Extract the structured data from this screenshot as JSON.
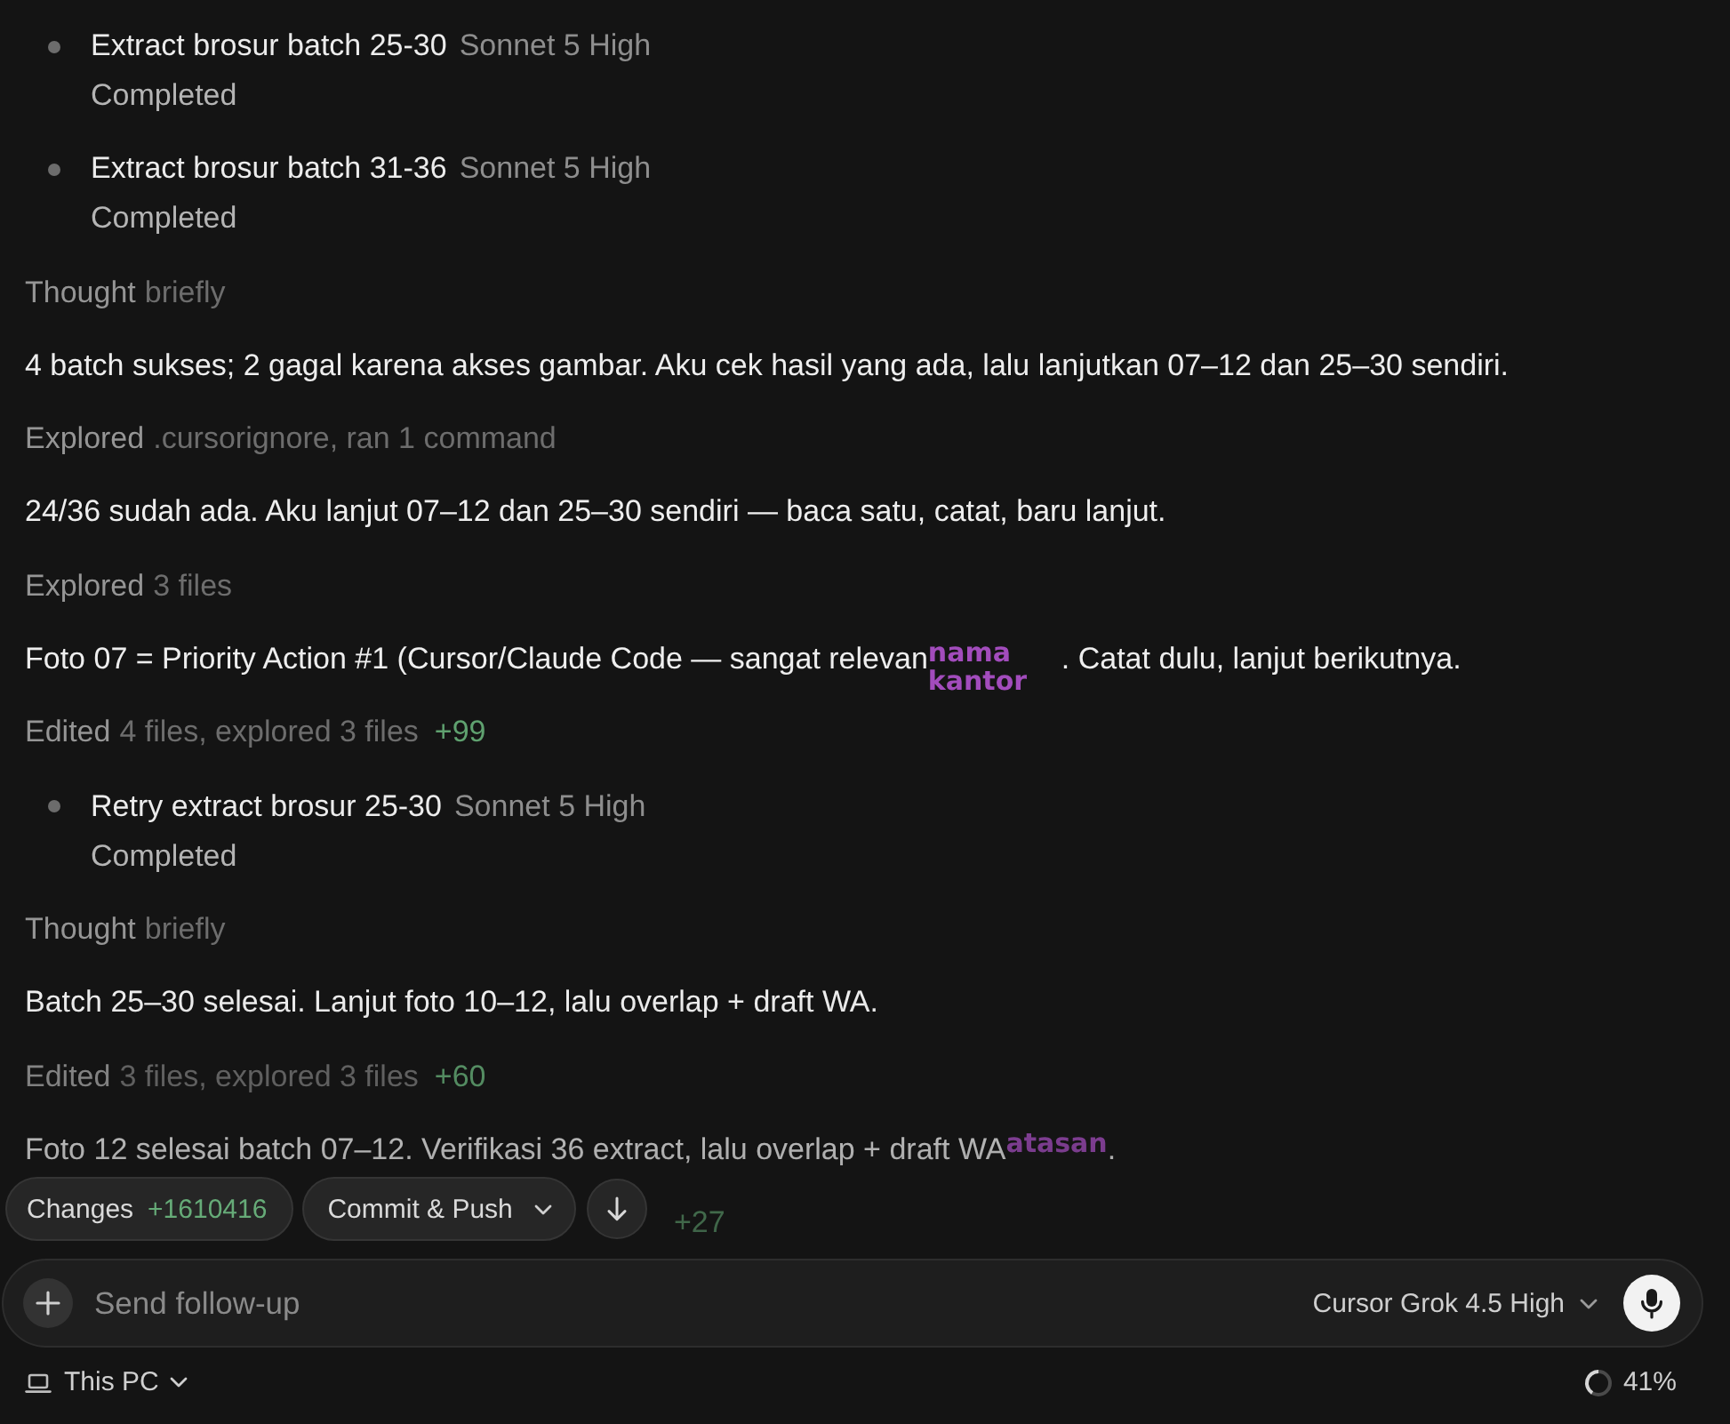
{
  "transcript": [
    {
      "kind": "task",
      "title": "Extract brosur batch 25-30",
      "model": "Sonnet 5 High",
      "status": "Completed"
    },
    {
      "kind": "task",
      "title": "Extract brosur batch 31-36",
      "model": "Sonnet 5 High",
      "status": "Completed"
    },
    {
      "kind": "summary",
      "label": "Thought",
      "detail": "briefly"
    },
    {
      "kind": "message",
      "text": "4 batch sukses; 2 gagal karena akses gambar. Aku cek hasil yang ada, lalu lanjutkan 07–12 dan 25–30 sendiri."
    },
    {
      "kind": "summary",
      "label": "Explored",
      "detail": ".cursorignore, ran 1 command"
    },
    {
      "kind": "message",
      "text": "24/36 sudah ada. Aku lanjut 07–12 dan 25–30 sendiri — baca satu, catat, baru lanjut."
    },
    {
      "kind": "summary",
      "label": "Explored",
      "detail": "3 files"
    },
    {
      "kind": "message",
      "parts": [
        {
          "kind": "text",
          "text": "Foto 07 = Priority Action #1 (Cursor/Claude Code — sangat relevan"
        },
        {
          "kind": "redaction",
          "text": "nama kantor"
        },
        {
          "kind": "text",
          "text": ". Catat dulu, lanjut berikutnya."
        }
      ]
    },
    {
      "kind": "summary",
      "label": "Edited",
      "detail": "4 files, explored 3 files",
      "diff": "+99"
    },
    {
      "kind": "task",
      "title": "Retry extract brosur 25-30",
      "model": "Sonnet 5 High",
      "status": "Completed"
    },
    {
      "kind": "summary",
      "label": "Thought",
      "detail": "briefly"
    },
    {
      "kind": "message",
      "text": "Batch 25–30 selesai. Lanjut foto 10–12, lalu overlap + draft WA."
    },
    {
      "kind": "summary",
      "label": "Edited",
      "detail": "3 files, explored 3 files",
      "diff": "+60"
    },
    {
      "kind": "message",
      "parts": [
        {
          "kind": "text",
          "text": "Foto 12 selesai batch 07–12. Verifikasi 36 extract, lalu overlap + draft WA"
        },
        {
          "kind": "redaction",
          "text": "atasan"
        },
        {
          "kind": "text",
          "text": "."
        }
      ]
    },
    {
      "kind": "summary",
      "diff": "+27"
    }
  ],
  "actions": {
    "changes": {
      "label": "Changes",
      "diff": "+1610416"
    },
    "commit": {
      "label": "Commit & Push"
    }
  },
  "composer": {
    "placeholder": "Send follow-up",
    "model": "Cursor Grok 4.5 High"
  },
  "footer": {
    "location": "This PC",
    "context": {
      "level": 0.41,
      "reading": "41%"
    }
  }
}
